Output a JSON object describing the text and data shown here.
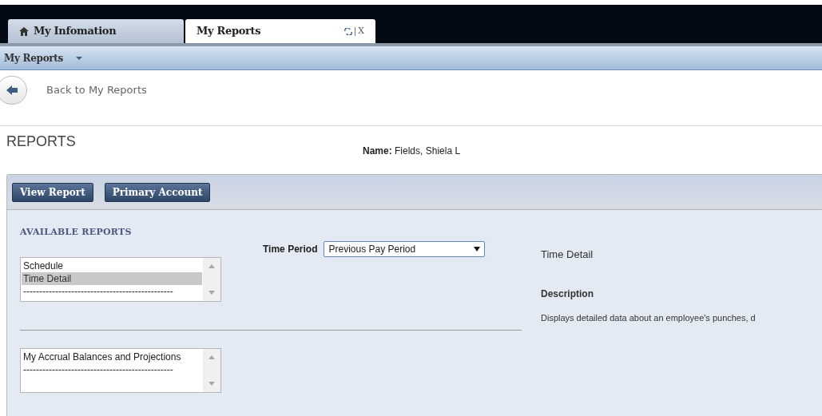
{
  "tabs": [
    {
      "label": "My Infomation",
      "selected": false
    },
    {
      "label": "My Reports",
      "selected": true
    }
  ],
  "tab_actions": {
    "close": "X"
  },
  "subnav": {
    "title": "My Reports"
  },
  "back_link": "Back to My Reports",
  "page_title": "REPORTS",
  "name_label": "Name:",
  "name_value": "Fields, Shiela L",
  "toolbar_buttons": [
    "View Report",
    "Primary Account"
  ],
  "section_title": "AVAILABLE REPORTS",
  "report_lists": [
    {
      "items": [
        {
          "label": "Schedule",
          "selected": false
        },
        {
          "label": "Time Detail",
          "selected": true
        },
        {
          "label": "-----------------------------------------------",
          "selected": false
        }
      ]
    },
    {
      "items": [
        {
          "label": "My Accrual Balances and Projections",
          "selected": false
        },
        {
          "label": "-----------------------------------------------",
          "selected": false
        }
      ]
    }
  ],
  "time_period": {
    "label": "Time Period",
    "value": "Previous Pay Period"
  },
  "detail": {
    "title": "Time Detail",
    "description_heading": "Description",
    "description": "Displays detailed data about an employee's punches, d"
  }
}
